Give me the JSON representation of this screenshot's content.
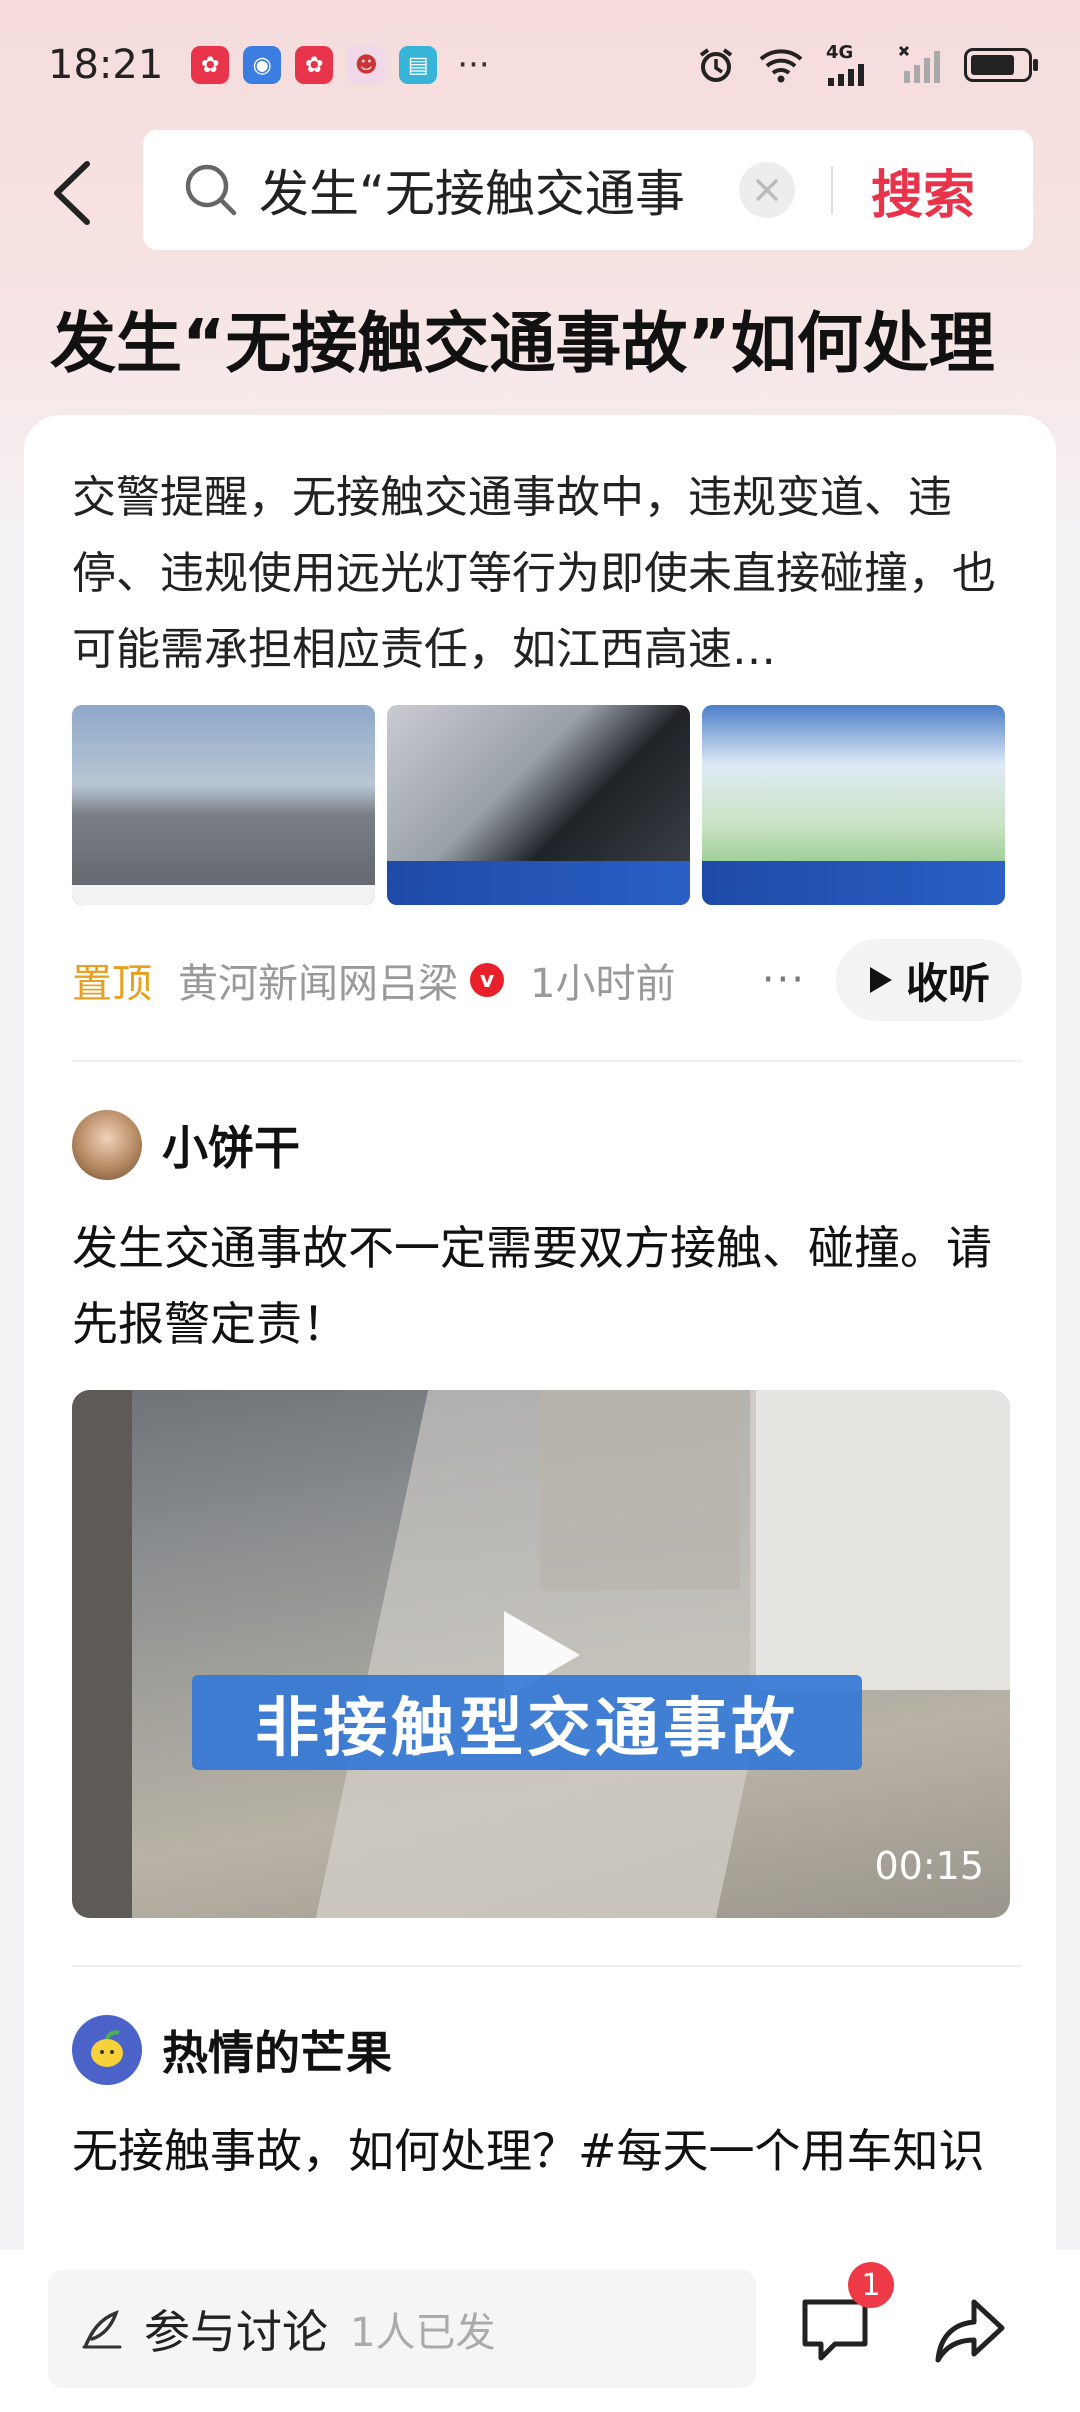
{
  "status_bar": {
    "time": "18:21",
    "app_icons": [
      "app-icon-red",
      "app-icon-blue",
      "app-icon-red",
      "app-icon-pink",
      "app-icon-cyan"
    ],
    "more": "···",
    "network": "4G",
    "battery_level": 0.7
  },
  "search": {
    "query": "发生“无接触交通事",
    "button_label": "搜索"
  },
  "page_title": "发生“无接触交通事故”如何处理",
  "article": {
    "summary": "交警提醒，无接触交通事故中，违规变道、违停、违规使用远光灯等行为即使未直接碰撞，也可能需承担相应责任，如江西高速…",
    "pinned_label": "置顶",
    "source": "黄河新闻网吕梁",
    "verified_badge": "v",
    "time_ago": "1小时前",
    "more": "···",
    "listen_label": "收听"
  },
  "posts": [
    {
      "username": "小饼干",
      "text": "发生交通事故不一定需要双方接触、碰撞。请先报警定责！",
      "video": {
        "caption": "非接触型交通事故",
        "duration": "00:15"
      }
    },
    {
      "username": "热情的芒果",
      "text": "无接触事故，如何处理？#每天一个用车知识"
    }
  ],
  "bottom_bar": {
    "cta": "参与讨论",
    "participants": "1人已发",
    "comment_count": "1"
  }
}
